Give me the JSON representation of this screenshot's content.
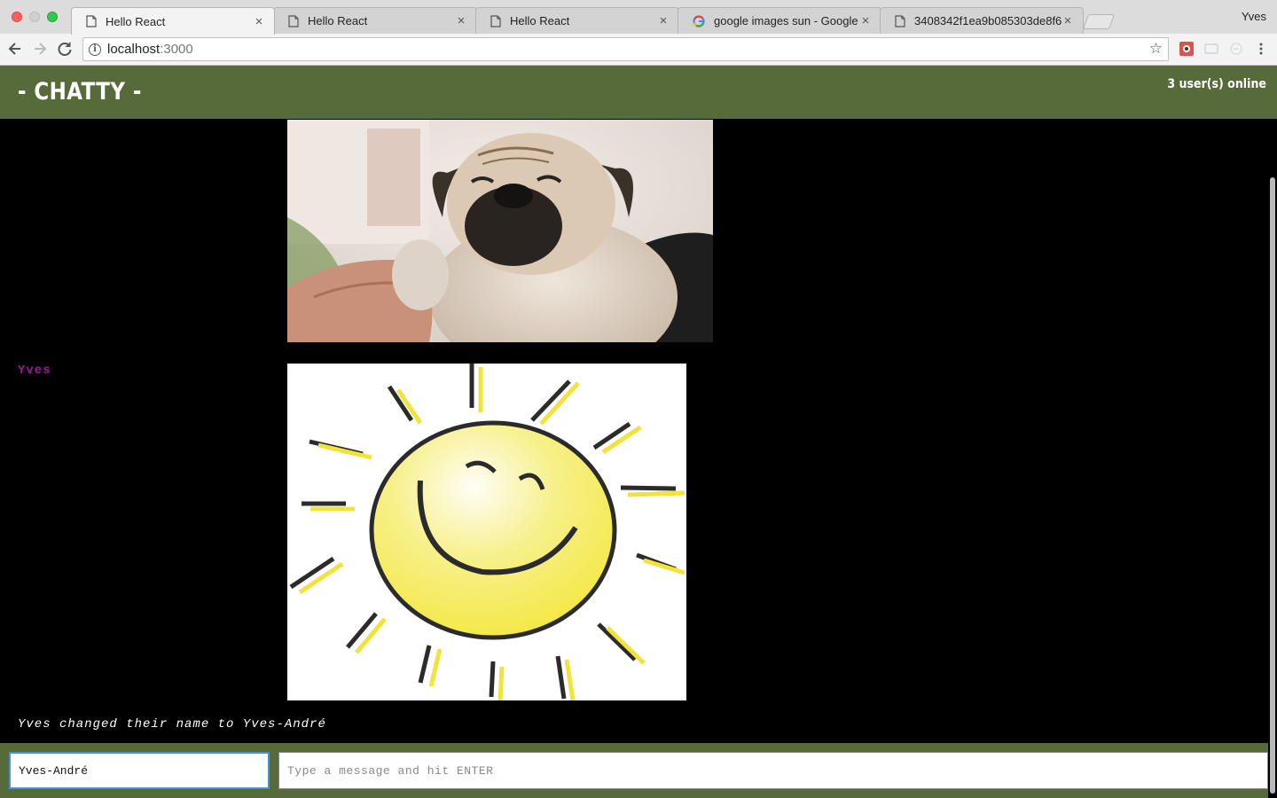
{
  "browser": {
    "tabs": [
      {
        "title": "Hello React",
        "favicon": "page-icon",
        "active": true
      },
      {
        "title": "Hello React",
        "favicon": "page-icon",
        "active": false
      },
      {
        "title": "Hello React",
        "favicon": "page-icon",
        "active": false
      },
      {
        "title": "google images sun - Google Se",
        "favicon": "google-icon",
        "active": false
      },
      {
        "title": "3408342f1ea9b085303de8f6",
        "favicon": "page-icon",
        "active": false
      }
    ],
    "close_glyph": "×",
    "profile_name": "Yves",
    "address": {
      "host": "localhost",
      "port": ":3000"
    }
  },
  "app": {
    "brand": "- CHATTY -",
    "online_count": "3 user(s) online"
  },
  "messages": [
    {
      "type": "image",
      "username": "",
      "content": "pug photo"
    },
    {
      "type": "image",
      "username": "Yves",
      "username_color": "#9b179b",
      "content": "smiling sun illustration"
    },
    {
      "type": "notification",
      "text": "Yves changed their name to Yves-André"
    }
  ],
  "composer": {
    "name_value": "Yves-André",
    "message_placeholder": "Type a message and hit ENTER"
  },
  "colors": {
    "header": "#566b39",
    "background": "#000000",
    "username": "#9b179b"
  }
}
